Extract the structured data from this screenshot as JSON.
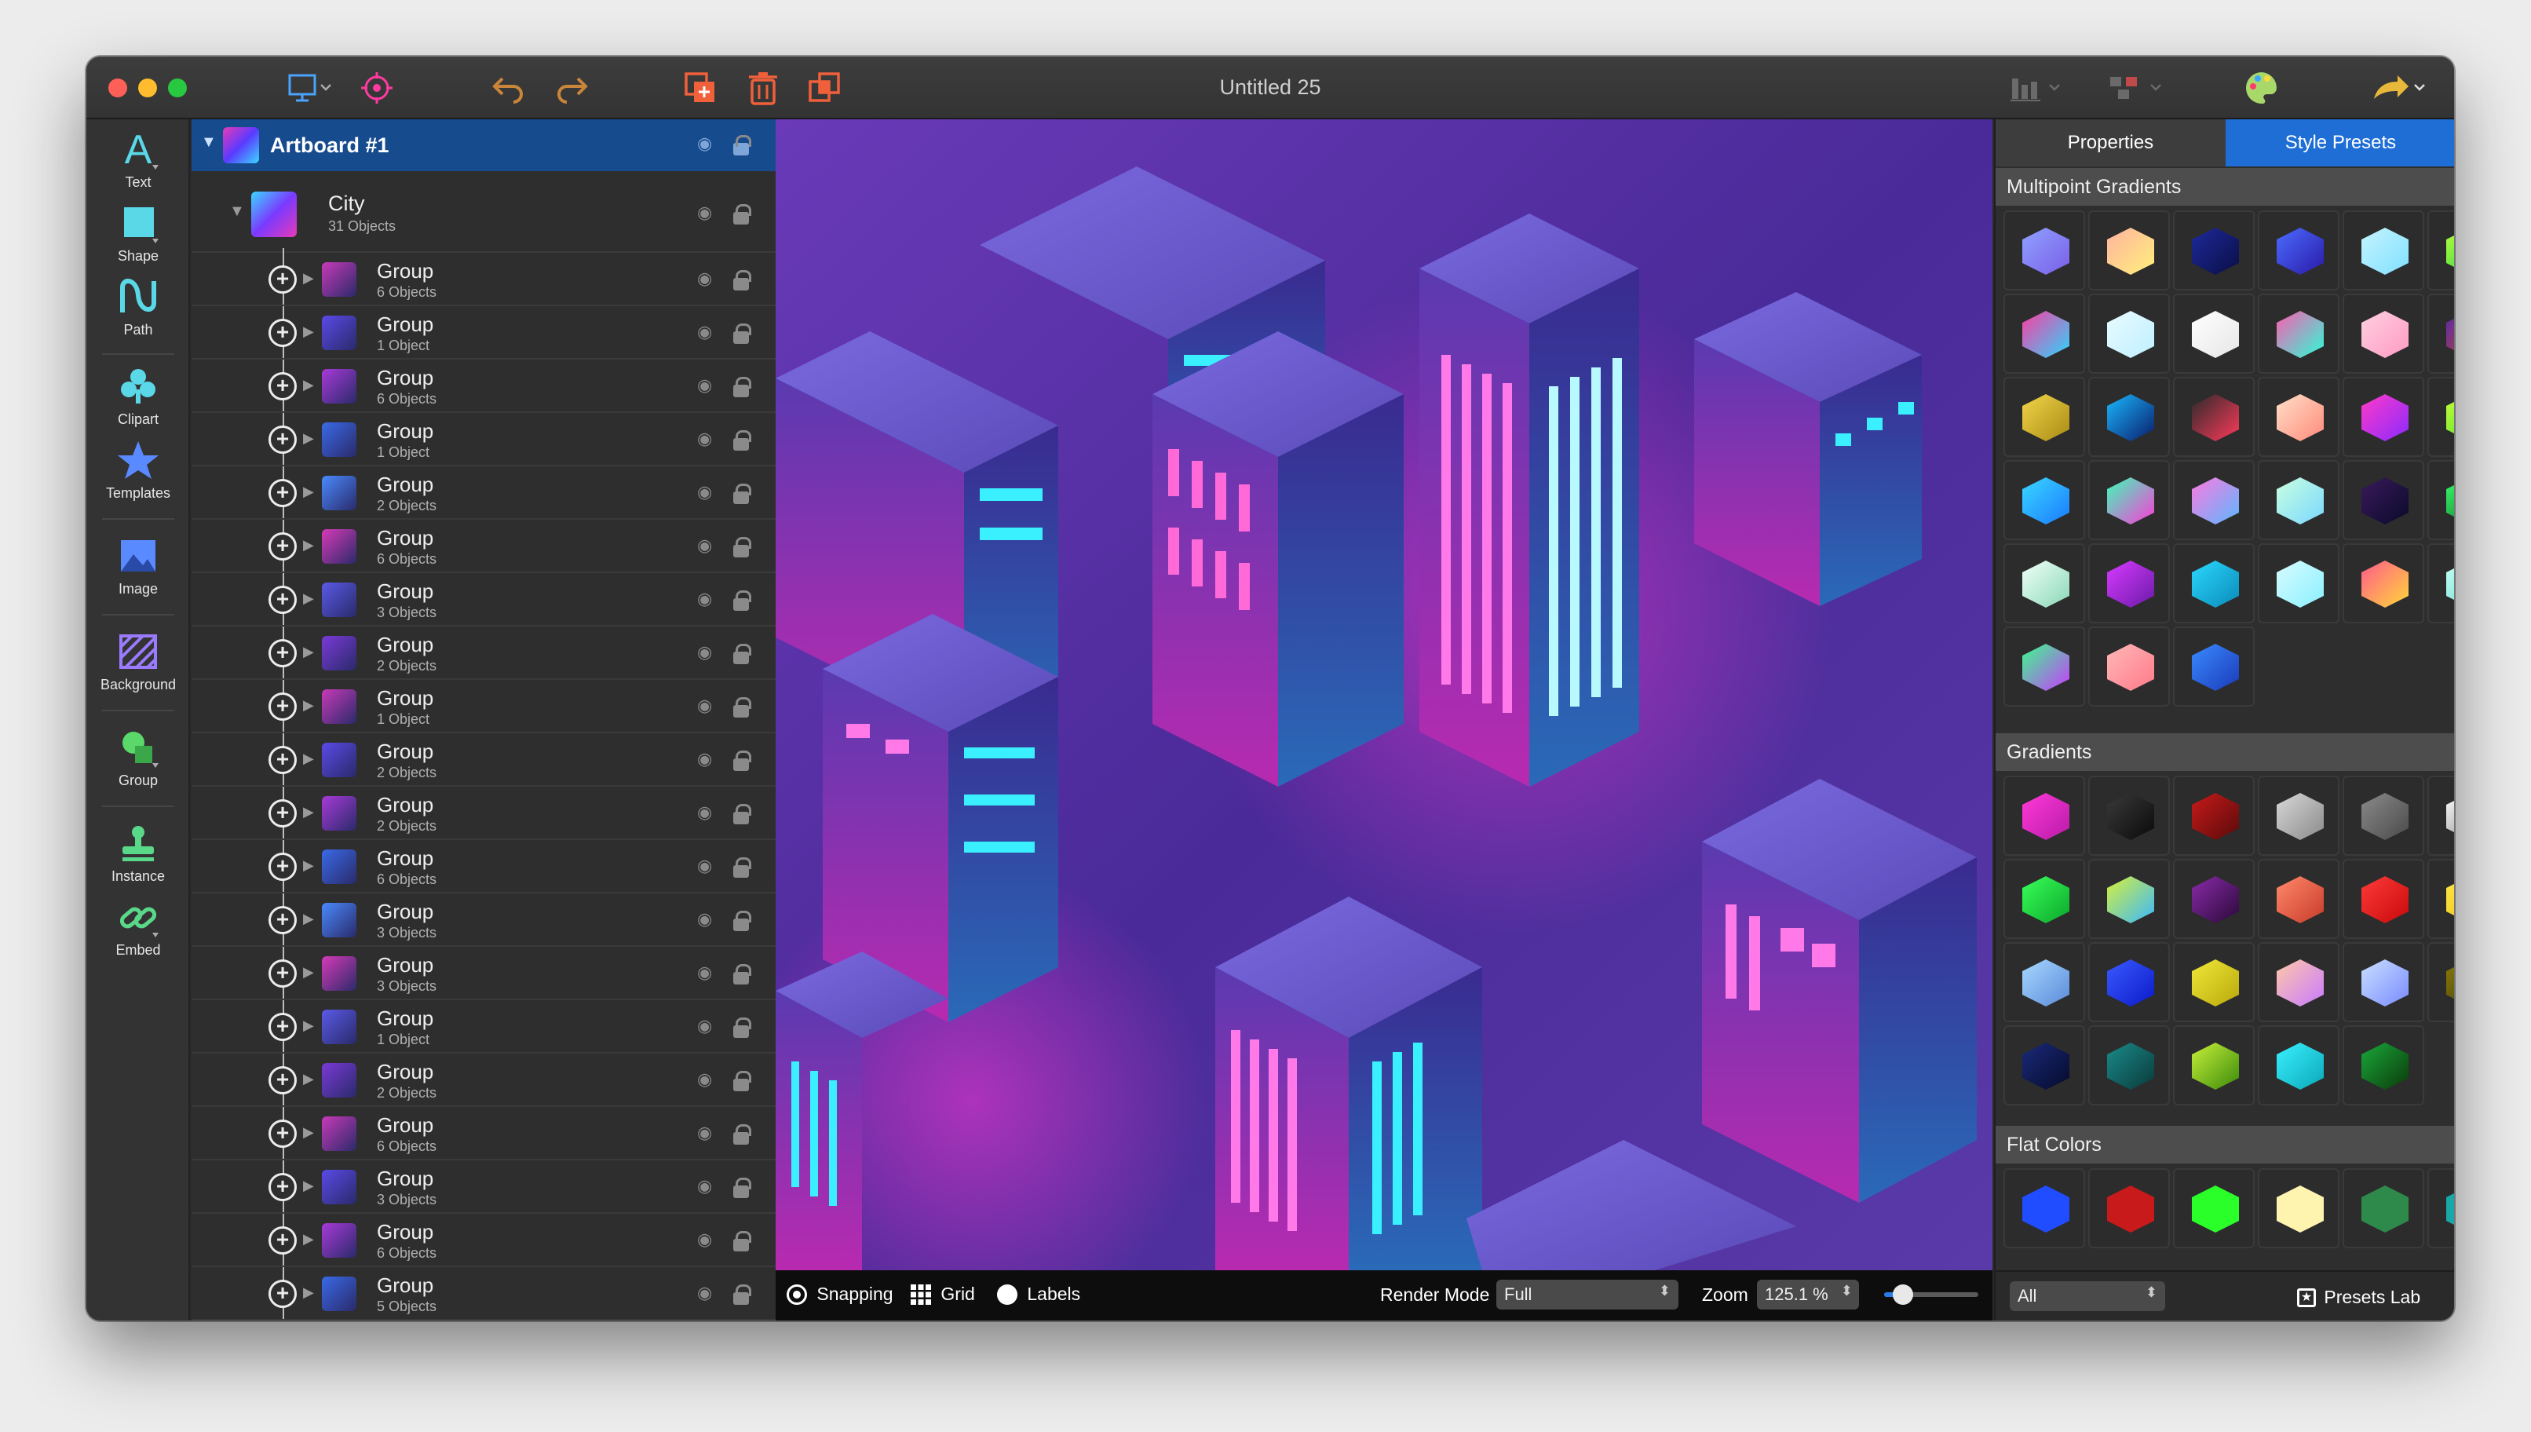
{
  "window": {
    "title": "Untitled 25"
  },
  "tools": [
    {
      "label": "Text",
      "icon": "text-tool-icon"
    },
    {
      "label": "Shape",
      "icon": "shape-tool-icon"
    },
    {
      "label": "Path",
      "icon": "path-tool-icon"
    },
    {
      "label": "Clipart",
      "icon": "clipart-icon"
    },
    {
      "label": "Templates",
      "icon": "templates-star-icon"
    },
    {
      "label": "Image",
      "icon": "image-icon"
    },
    {
      "label": "Background",
      "icon": "background-icon"
    },
    {
      "label": "Group",
      "icon": "group-icon"
    },
    {
      "label": "Instance",
      "icon": "instance-icon"
    },
    {
      "label": "Embed",
      "icon": "embed-link-icon"
    }
  ],
  "layers": {
    "artboard": "Artboard #1",
    "city": {
      "name": "City",
      "count": "31 Objects"
    },
    "groups": [
      {
        "name": "Group",
        "count": "6 Objects"
      },
      {
        "name": "Group",
        "count": "1 Object"
      },
      {
        "name": "Group",
        "count": "6 Objects"
      },
      {
        "name": "Group",
        "count": "1 Object"
      },
      {
        "name": "Group",
        "count": "2 Objects"
      },
      {
        "name": "Group",
        "count": "6 Objects"
      },
      {
        "name": "Group",
        "count": "3 Objects"
      },
      {
        "name": "Group",
        "count": "2 Objects"
      },
      {
        "name": "Group",
        "count": "1 Object"
      },
      {
        "name": "Group",
        "count": "2 Objects"
      },
      {
        "name": "Group",
        "count": "2 Objects"
      },
      {
        "name": "Group",
        "count": "6 Objects"
      },
      {
        "name": "Group",
        "count": "3 Objects"
      },
      {
        "name": "Group",
        "count": "3 Objects"
      },
      {
        "name": "Group",
        "count": "1 Object"
      },
      {
        "name": "Group",
        "count": "2 Objects"
      },
      {
        "name": "Group",
        "count": "6 Objects"
      },
      {
        "name": "Group",
        "count": "3 Objects"
      },
      {
        "name": "Group",
        "count": "6 Objects"
      },
      {
        "name": "Group",
        "count": "5 Objects"
      }
    ]
  },
  "status": {
    "snapping": "Snapping",
    "grid": "Grid",
    "labels": "Labels",
    "render_mode_label": "Render Mode",
    "render_mode_value": "Full",
    "zoom_label": "Zoom",
    "zoom_value": "125.1 %",
    "zoom_slider": 0.2
  },
  "panel": {
    "tabs": [
      "Properties",
      "Style Presets"
    ],
    "active_tab": "Style Presets",
    "sections": {
      "multipoint": "Multipoint Gradients",
      "gradients": "Gradients",
      "flat": "Flat Colors"
    },
    "filter_value": "All",
    "presets_lab": "Presets Lab"
  },
  "colors": {
    "accent": "#1e6ed6",
    "artboard_selection": "#164b8e",
    "multipoint_swatches": [
      [
        "#8fa2ff",
        "#7a5ee8"
      ],
      [
        "#ffb3a0",
        "#fff07a"
      ],
      [
        "#1c2a9a",
        "#0a0e45"
      ],
      [
        "#4b6cff",
        "#2a1aa8"
      ],
      [
        "#c6f4ff",
        "#7fe0ff"
      ],
      [
        "#b9ff3c",
        "#14c94a"
      ],
      [
        "#ff3ca0",
        "#2ad6ff"
      ],
      [
        "#e8fbff",
        "#bfefff"
      ],
      [
        "#ffffff",
        "#e6e6e6"
      ],
      [
        "#ff5ab0",
        "#2affd8"
      ],
      [
        "#ffd0e0",
        "#ff9ac2"
      ],
      [
        "#5a2aa8",
        "#c24a2a"
      ],
      [
        "#f2d54a",
        "#a88a14"
      ],
      [
        "#1ab8ff",
        "#0a1c6a"
      ],
      [
        "#2a2a2a",
        "#ff3a5a"
      ],
      [
        "#ffe0c8",
        "#ff8a7a"
      ],
      [
        "#ff3ac8",
        "#8a2aff"
      ],
      [
        "#c8ff3a",
        "#3ad82a"
      ],
      [
        "#3ad8ff",
        "#1a7aff"
      ],
      [
        "#3affb8",
        "#ff3ad8"
      ],
      [
        "#ff7ae0",
        "#5ab8ff"
      ],
      [
        "#c8ffe0",
        "#7ad8ff"
      ],
      [
        "#3a1a5a",
        "#0a0a2a"
      ],
      [
        "#3aff6a",
        "#0a5a2a"
      ],
      [
        "#f0fff8",
        "#8ad8b8"
      ],
      [
        "#d83aff",
        "#6a1aa8"
      ],
      [
        "#2ad8ff",
        "#0a8ab8"
      ],
      [
        "#d8fbff",
        "#8af0ff"
      ],
      [
        "#ff5a8a",
        "#ffd83a"
      ],
      [
        "#c8fff0",
        "#5ad8d8"
      ],
      [
        "#3aff8a",
        "#c83aff"
      ],
      [
        "#ffb8b8",
        "#ff7a8a"
      ],
      [
        "#3a8aff",
        "#1a3ab8"
      ]
    ],
    "gradient_swatches": [
      [
        "#ff3ad8",
        "#b81aa8"
      ],
      [
        "#3a3a3a",
        "#0a0a0a"
      ],
      [
        "#c81a1a",
        "#5a0a0a"
      ],
      [
        "#d8d8d8",
        "#8a8a8a"
      ],
      [
        "#8a8a8a",
        "#4a4a4a"
      ],
      [
        "#ffffff",
        "#7a7a7a"
      ],
      [
        "#3aff5a",
        "#0aa82a"
      ],
      [
        "#d8f03a",
        "#3ab8ff"
      ],
      [
        "#8a2aa8",
        "#2a0a3a"
      ],
      [
        "#ff8a6a",
        "#c83a2a"
      ],
      [
        "#ff3a3a",
        "#c80a0a"
      ],
      [
        "#ffe84a",
        "#e8b80a"
      ],
      [
        "#a8d8ff",
        "#5a8ad8"
      ],
      [
        "#3a5aff",
        "#0a1ac8"
      ],
      [
        "#f0e83a",
        "#b8a80a"
      ],
      [
        "#ffc8a8",
        "#c87aff"
      ],
      [
        "#c8e0ff",
        "#7a8aff"
      ],
      [
        "#8a7a0a",
        "#3a3a0a"
      ],
      [
        "#1a2a7a",
        "#050a2a"
      ],
      [
        "#1a8a8a",
        "#0a3a3a"
      ],
      [
        "#c8f03a",
        "#3a8a0a"
      ],
      [
        "#3af0ff",
        "#0aa8b8"
      ],
      [
        "#1aa83a",
        "#0a3a0a"
      ]
    ],
    "flat_swatches": [
      "#1f4dff",
      "#c81a1a",
      "#2aff2a",
      "#fff3b0",
      "#2e8a4a",
      "#18a8a8"
    ]
  }
}
